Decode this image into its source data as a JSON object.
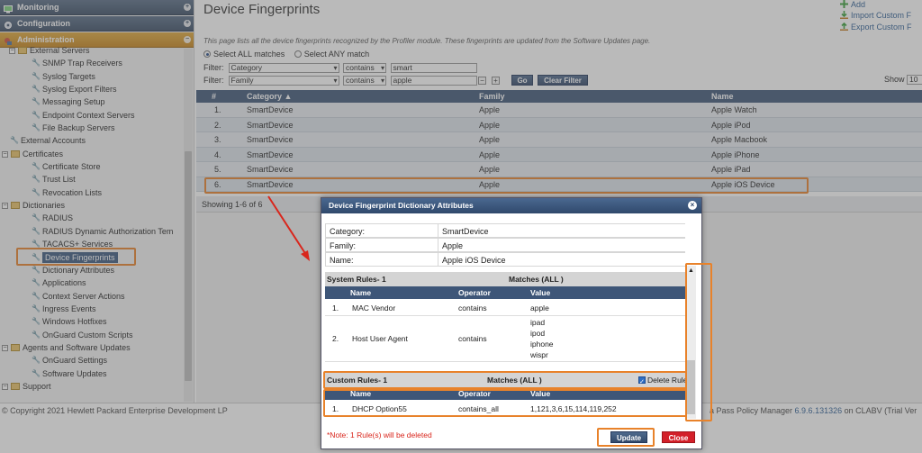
{
  "sidebar": {
    "sections": [
      {
        "label": "Monitoring"
      },
      {
        "label": "Configuration"
      },
      {
        "label": "Administration"
      }
    ],
    "tree": [
      {
        "label": "External Servers",
        "level": 1,
        "kind": "folder"
      },
      {
        "label": "SNMP Trap Receivers",
        "level": 2,
        "kind": "leaf"
      },
      {
        "label": "Syslog Targets",
        "level": 2,
        "kind": "leaf"
      },
      {
        "label": "Syslog Export Filters",
        "level": 2,
        "kind": "leaf"
      },
      {
        "label": "Messaging Setup",
        "level": 2,
        "kind": "leaf"
      },
      {
        "label": "Endpoint Context Servers",
        "level": 2,
        "kind": "leaf"
      },
      {
        "label": "File Backup Servers",
        "level": 2,
        "kind": "leaf"
      },
      {
        "label": "External Accounts",
        "level": 1,
        "kind": "leaf"
      },
      {
        "label": "Certificates",
        "level": 0,
        "kind": "folder"
      },
      {
        "label": "Certificate Store",
        "level": 2,
        "kind": "leaf"
      },
      {
        "label": "Trust List",
        "level": 2,
        "kind": "leaf"
      },
      {
        "label": "Revocation Lists",
        "level": 2,
        "kind": "leaf"
      },
      {
        "label": "Dictionaries",
        "level": 0,
        "kind": "folder"
      },
      {
        "label": "RADIUS",
        "level": 2,
        "kind": "leaf"
      },
      {
        "label": "RADIUS Dynamic Authorization Tem",
        "level": 2,
        "kind": "leaf"
      },
      {
        "label": "TACACS+ Services",
        "level": 2,
        "kind": "leaf"
      },
      {
        "label": "Device Fingerprints",
        "level": 2,
        "kind": "leaf",
        "selected": true
      },
      {
        "label": "Dictionary Attributes",
        "level": 2,
        "kind": "leaf"
      },
      {
        "label": "Applications",
        "level": 2,
        "kind": "leaf"
      },
      {
        "label": "Context Server Actions",
        "level": 2,
        "kind": "leaf"
      },
      {
        "label": "Ingress Events",
        "level": 2,
        "kind": "leaf"
      },
      {
        "label": "Windows Hotfixes",
        "level": 2,
        "kind": "leaf"
      },
      {
        "label": "OnGuard Custom Scripts",
        "level": 2,
        "kind": "leaf"
      },
      {
        "label": "Agents and Software Updates",
        "level": 0,
        "kind": "folder"
      },
      {
        "label": "OnGuard Settings",
        "level": 2,
        "kind": "leaf"
      },
      {
        "label": "Software Updates",
        "level": 2,
        "kind": "leaf"
      },
      {
        "label": "Support",
        "level": 0,
        "kind": "folder"
      }
    ]
  },
  "page": {
    "title": "Device Fingerprints",
    "actions": [
      "Add",
      "Import Custom F",
      "Export Custom F"
    ],
    "description": "This page lists all the device fingerprints recognized by the Profiler module. These fingerprints are updated from the Software Updates page.",
    "match_all": "Select ALL matches",
    "match_any": "Select ANY match",
    "filter_label": "Filter:",
    "filters": [
      {
        "field": "Category",
        "op": "contains",
        "value": "smart"
      },
      {
        "field": "Family",
        "op": "contains",
        "value": "apple"
      }
    ],
    "go": "Go",
    "clear_filter": "Clear Filter",
    "show_label": "Show",
    "show_value": "10",
    "columns": [
      "#",
      "Category ▲",
      "Family",
      "Name"
    ],
    "rows": [
      [
        "1.",
        "SmartDevice",
        "Apple",
        "Apple Watch"
      ],
      [
        "2.",
        "SmartDevice",
        "Apple",
        "Apple iPod"
      ],
      [
        "3.",
        "SmartDevice",
        "Apple",
        "Apple Macbook"
      ],
      [
        "4.",
        "SmartDevice",
        "Apple",
        "Apple iPhone"
      ],
      [
        "5.",
        "SmartDevice",
        "Apple",
        "Apple iPad"
      ],
      [
        "6.",
        "SmartDevice",
        "Apple",
        "Apple iOS Device"
      ]
    ],
    "showing": "Showing 1-6 of 6"
  },
  "footer": {
    "copyright": "© Copyright 2021 Hewlett Packard Enterprise Development LP",
    "right_prefix": "a Pass Policy Manager ",
    "version": "6.9.6.131326",
    "right_suffix": " on CLABV (Trial Ver"
  },
  "dialog": {
    "title": "Device Fingerprint Dictionary Attributes",
    "attrs": [
      {
        "key": "Category:",
        "value": "SmartDevice"
      },
      {
        "key": "Family:",
        "value": "Apple"
      },
      {
        "key": "Name:",
        "value": "Apple iOS Device"
      }
    ],
    "system_rules_label": "System Rules- 1",
    "system_matches": "Matches (ALL )",
    "rule_columns": [
      "Name",
      "Operator",
      "Value"
    ],
    "system_rules": [
      {
        "n": "1.",
        "name": "MAC Vendor",
        "op": "contains",
        "values": [
          "apple"
        ]
      },
      {
        "n": "2.",
        "name": "Host User Agent",
        "op": "contains",
        "values": [
          "ipad",
          "ipod",
          "iphone",
          "wispr"
        ]
      }
    ],
    "custom_rules_label": "Custom Rules- 1",
    "custom_matches": "Matches (ALL )",
    "delete_label": "Delete Rule",
    "custom_rules": [
      {
        "n": "1.",
        "name": "DHCP Option55",
        "op": "contains_all",
        "value": "1,121,3,6,15,114,119,252"
      }
    ],
    "note": "*Note: 1 Rule(s) will be deleted",
    "update": "Update",
    "close": "Close"
  },
  "colors": {
    "accent": "#e8822a",
    "header": "#3e5678",
    "danger": "#d3202a"
  }
}
